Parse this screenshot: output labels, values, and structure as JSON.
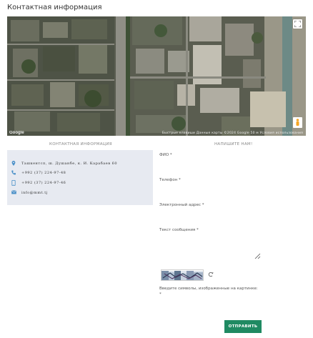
{
  "page": {
    "title": "Контактная информация"
  },
  "map": {
    "logo": "Google",
    "attribution": "Быстрые клавиши  Данные карты ©2024 Google  50 м  Условия использования"
  },
  "contacts": {
    "heading": "КОНТАКТНАЯ ИНФОРМАЦИЯ",
    "address": "Ташкентсп, ш. Душанбе, к. И. Карабаев 60",
    "phone": "+992 (37) 224-97-48",
    "mobile": "+992 (37) 224-97-46",
    "email": "info@mmt.tj"
  },
  "form": {
    "heading": "НАПИШИТЕ НАМ!",
    "name_label": "ФИО *",
    "phone_label": "Телефон *",
    "email_label": "Электронный адрес *",
    "message_label": "Текст сообщения *",
    "captcha_label": "Введите символы, изображенные на картинке:",
    "captcha_required": "*",
    "submit_label": "ОТПРАВИТЬ"
  },
  "colors": {
    "accent": "#1f8a62",
    "icon": "#4a90c8",
    "panel": "#e7eaf1"
  }
}
